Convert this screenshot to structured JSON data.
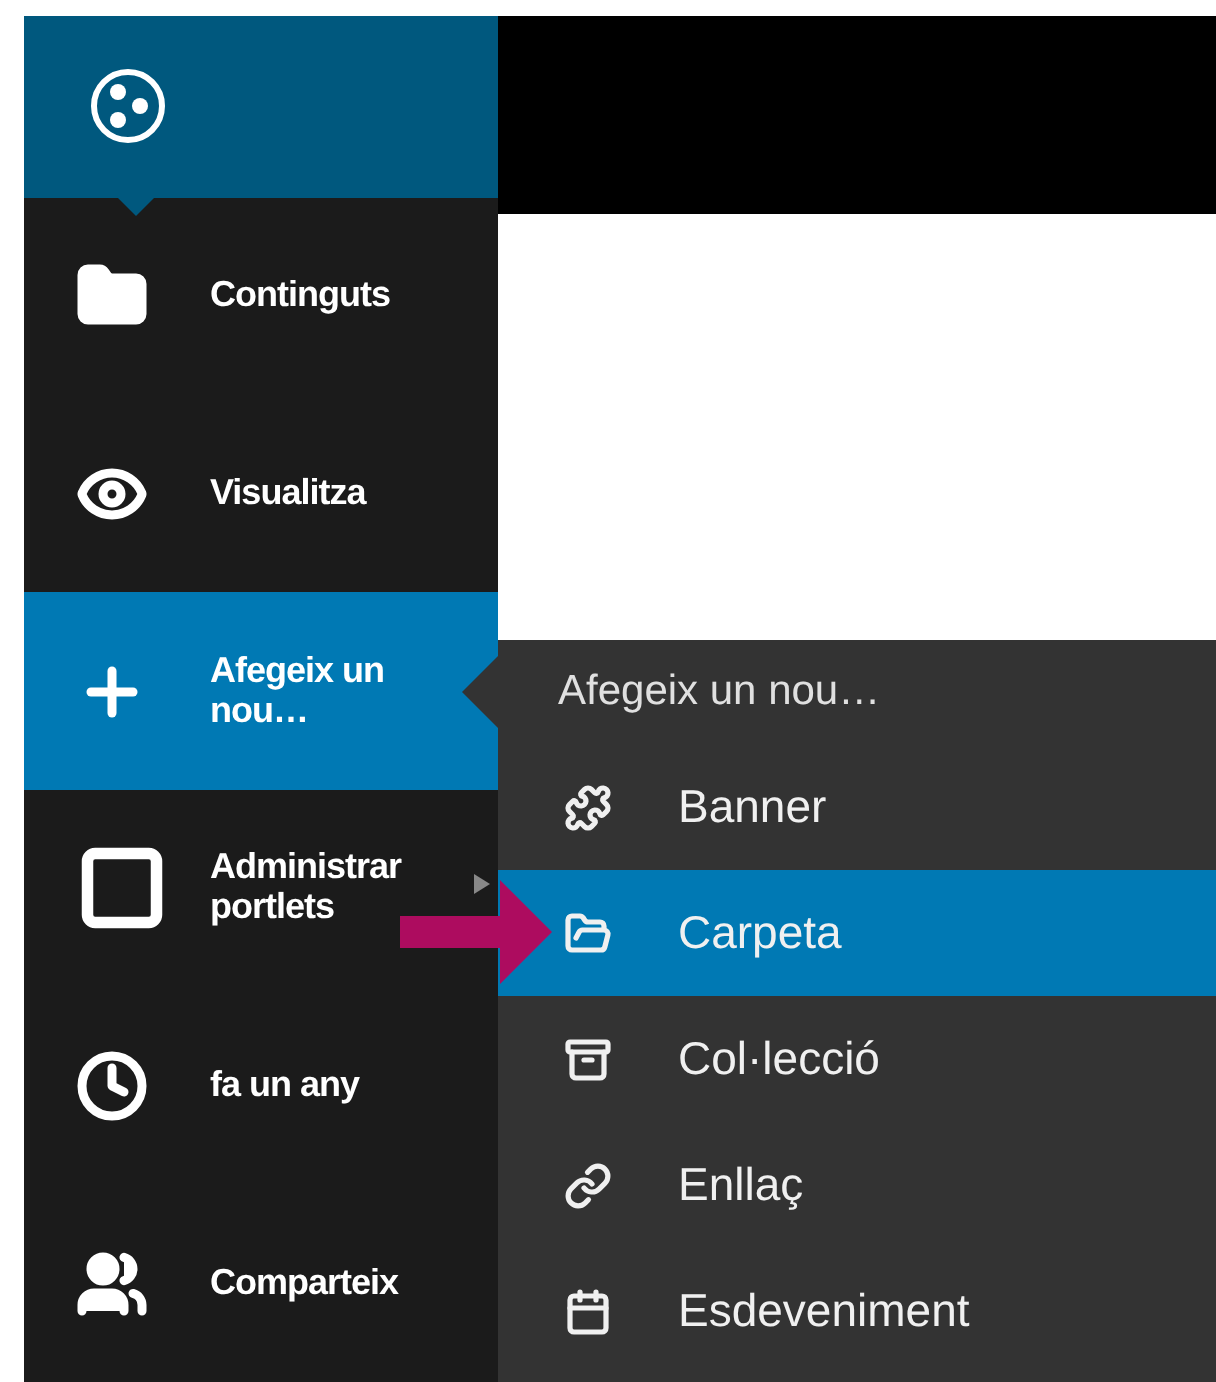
{
  "sidebar": {
    "items": [
      {
        "label": "Continguts",
        "selected": false,
        "submenu": false
      },
      {
        "label": "Visualitza",
        "selected": false,
        "submenu": false
      },
      {
        "label": "Afegeix un nou…",
        "selected": true,
        "submenu": false
      },
      {
        "label": "Administrar portlets",
        "selected": false,
        "submenu": true
      },
      {
        "label": "fa un any",
        "selected": false,
        "submenu": false
      },
      {
        "label": "Comparteix",
        "selected": false,
        "submenu": false
      }
    ]
  },
  "add_menu": {
    "title": "Afegeix un nou…",
    "items": [
      {
        "label": "Banner",
        "selected": false
      },
      {
        "label": "Carpeta",
        "selected": true
      },
      {
        "label": "Col·lecció",
        "selected": false
      },
      {
        "label": "Enllaç",
        "selected": false
      },
      {
        "label": "Esdeveniment",
        "selected": false
      }
    ]
  }
}
